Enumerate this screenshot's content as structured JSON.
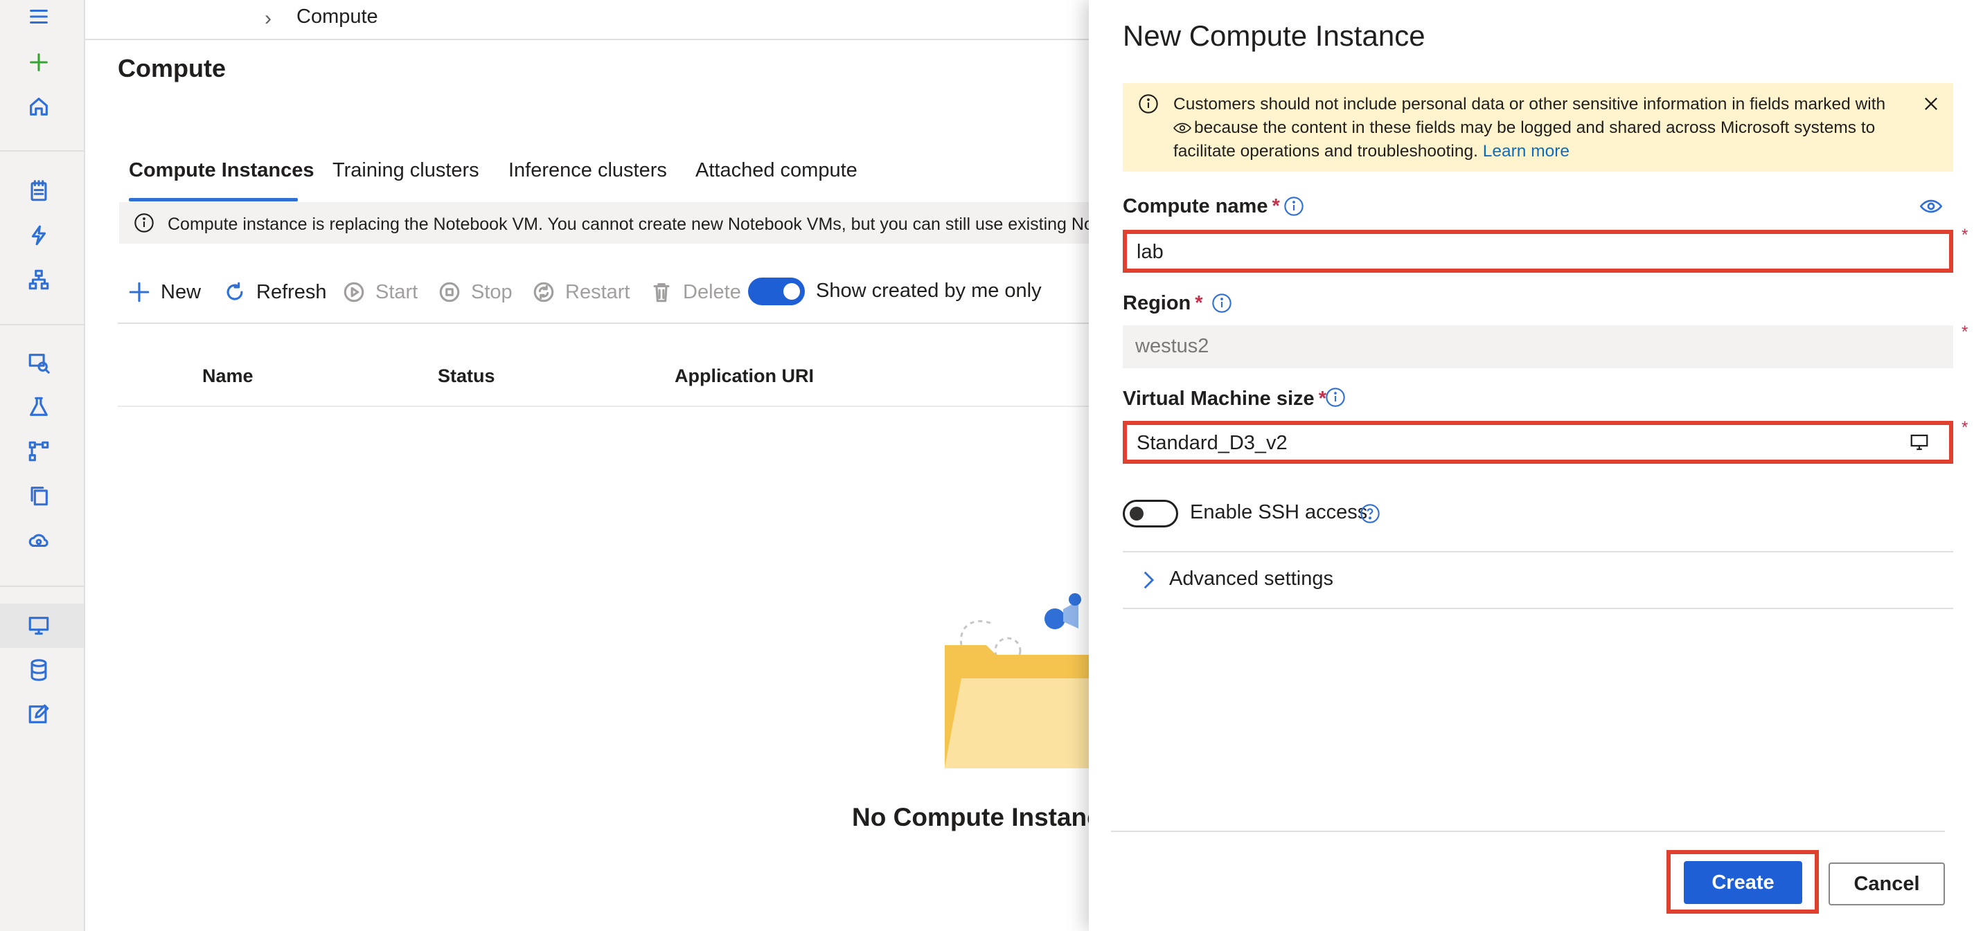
{
  "breadcrumb": {
    "current": "Compute"
  },
  "page": {
    "title": "Compute"
  },
  "tabs": [
    {
      "label": "Compute Instances",
      "active": true
    },
    {
      "label": "Training clusters",
      "active": false
    },
    {
      "label": "Inference clusters",
      "active": false
    },
    {
      "label": "Attached compute",
      "active": false
    }
  ],
  "infobar": {
    "text": "Compute instance is replacing the Notebook VM. You cannot create new Notebook VMs, but you can still use existing Notebo"
  },
  "toolbar": {
    "new_label": "New",
    "refresh_label": "Refresh",
    "start_label": "Start",
    "stop_label": "Stop",
    "restart_label": "Restart",
    "delete_label": "Delete",
    "show_mine_label": "Show created by me only",
    "show_mine_on": true
  },
  "table": {
    "columns": [
      "Name",
      "Status",
      "Application URI"
    ]
  },
  "empty_state": {
    "title": "No Compute Instance"
  },
  "panel": {
    "title": "New Compute Instance",
    "warning": {
      "text_before_icon": "Customers should not include personal data or other sensitive information in fields marked with",
      "text_after_icon": "because the content in these fields may be logged and shared across Microsoft systems to facilitate operations and troubleshooting.",
      "link": "Learn more"
    },
    "compute_name": {
      "label": "Compute name",
      "required": "*",
      "value": "lab"
    },
    "region": {
      "label": "Region",
      "required": "*",
      "value": "westus2"
    },
    "vm_size": {
      "label": "Virtual Machine size",
      "required": "*",
      "value": "Standard_D3_v2"
    },
    "ssh": {
      "label": "Enable SSH access",
      "enabled": false
    },
    "advanced": {
      "label": "Advanced settings"
    },
    "side_star": "*",
    "create_label": "Create",
    "cancel_label": "Cancel"
  },
  "colors": {
    "accent": "#1f5fd6",
    "highlight_outline": "#e0402e",
    "warning_bg": "#fff4ce"
  }
}
